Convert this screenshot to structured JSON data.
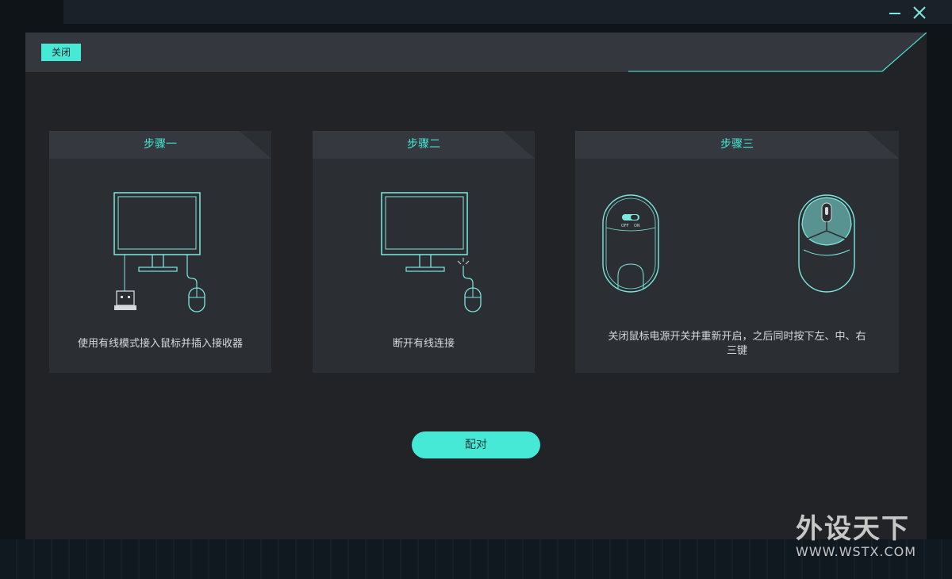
{
  "window": {
    "minimize_icon": "minimize-icon",
    "close_icon": "close-icon"
  },
  "dialog": {
    "close_label": "关闭"
  },
  "steps": [
    {
      "title": "步骤一",
      "text": "使用有线模式接入鼠标并插入接收器",
      "icon": "monitor-wired-receiver-illustration"
    },
    {
      "title": "步骤二",
      "text": "断开有线连接",
      "icon": "monitor-disconnect-illustration"
    },
    {
      "title": "步骤三",
      "text_line1": "关闭鼠标电源开关并重新开启，之后同时按下左、中、右",
      "text_line2": "三键",
      "icon": "mouse-switch-illustration",
      "switch_off": "OFF",
      "switch_on": "ON"
    }
  ],
  "actions": {
    "pair_label": "配对"
  },
  "watermark": {
    "main": "外设天下",
    "sub": "WWW.WSTX.COM"
  },
  "colors": {
    "accent": "#45e9d6",
    "panel": "#212327",
    "card": "#2b2e33"
  }
}
